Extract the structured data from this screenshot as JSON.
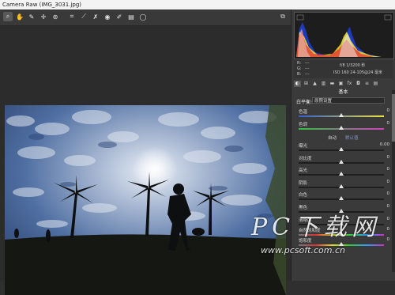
{
  "window": {
    "title": "Camera Raw (IMG_3031.jpg)"
  },
  "toolbar": {
    "tools": [
      {
        "name": "zoom-tool-icon",
        "glyph": "⌕",
        "active": true
      },
      {
        "name": "hand-tool-icon",
        "glyph": "✋",
        "active": false
      },
      {
        "name": "white-balance-tool-icon",
        "glyph": "✎",
        "active": false
      },
      {
        "name": "color-sampler-tool-icon",
        "glyph": "✛",
        "active": false
      },
      {
        "name": "targeted-adjustment-tool-icon",
        "glyph": "⊚",
        "active": false
      },
      {
        "name": "crop-tool-icon",
        "glyph": "⌗",
        "active": false
      },
      {
        "name": "straighten-tool-icon",
        "glyph": "⟋",
        "active": false
      },
      {
        "name": "spot-removal-tool-icon",
        "glyph": "✗",
        "active": false
      },
      {
        "name": "red-eye-tool-icon",
        "glyph": "◉",
        "active": false
      },
      {
        "name": "adjustment-brush-icon",
        "glyph": "✐",
        "active": false
      },
      {
        "name": "graduated-filter-icon",
        "glyph": "▤",
        "active": false
      },
      {
        "name": "radial-filter-icon",
        "glyph": "◯",
        "active": false
      }
    ],
    "right_icon": "open-preferences-icon"
  },
  "readout": {
    "r": "R:",
    "g": "G:",
    "b": "B:",
    "dash": "---",
    "exposure": "f/8  1/3200 秒",
    "iso": "ISO 160  24-105@24 毫米"
  },
  "panel": {
    "section_title": "基本",
    "white_balance": {
      "label": "白平衡:",
      "value": "原照设置"
    },
    "auto": "自动",
    "default": "默认值",
    "sliders_wb": [
      {
        "label": "色温",
        "value": "0"
      },
      {
        "label": "色调",
        "value": "0"
      }
    ],
    "sliders_tone": [
      {
        "label": "曝光",
        "value": "0.00"
      },
      {
        "label": "对比度",
        "value": "0"
      },
      {
        "label": "高光",
        "value": "0"
      },
      {
        "label": "阴影",
        "value": "0"
      },
      {
        "label": "白色",
        "value": "0"
      },
      {
        "label": "黑色",
        "value": "0"
      }
    ],
    "sliders_presence": [
      {
        "label": "清晰度",
        "value": "0"
      },
      {
        "label": "自然饱和度",
        "value": "0"
      },
      {
        "label": "饱和度",
        "value": "0"
      }
    ]
  },
  "watermark": {
    "big": "PC下载网",
    "small": "www.pcsoft.com.cn"
  }
}
